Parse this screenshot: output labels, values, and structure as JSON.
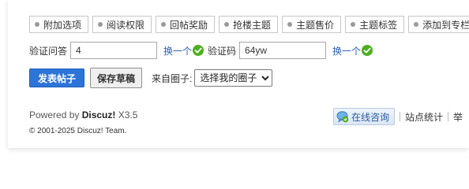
{
  "tabs": [
    {
      "label": "附加选项"
    },
    {
      "label": "阅读权限"
    },
    {
      "label": "回帖奖励"
    },
    {
      "label": "抢楼主题"
    },
    {
      "label": "主题售价"
    },
    {
      "label": "主题标签"
    },
    {
      "label": "添加到专栏"
    }
  ],
  "captcha": {
    "question_label": "验证问答",
    "question_value": "4",
    "refresh_label": "换一个",
    "code_label": "验证码",
    "code_value": "64yw",
    "refresh_label_2": "换一个"
  },
  "actions": {
    "submit_label": "发表帖子",
    "draft_label": "保存草稿",
    "circle_label": "来自圈子:",
    "circle_selected": "选择我的圈子"
  },
  "footer": {
    "powered_prefix": "Powered by ",
    "brand": "Discuz!",
    "version": " X3.5",
    "copyright": "© 2001-2025 Discuz! Team.",
    "consult_label": "在线咨询",
    "stats_label": "站点统计",
    "partial_label": "举"
  },
  "colors": {
    "accent": "#2c74d8",
    "link": "#2b62b8",
    "ok_green": "#4caf1f"
  },
  "icons": {
    "tab_bullet": "bullet-dot-icon",
    "captcha_ok": "check-circle-icon",
    "consult": "chat-bubble-icon"
  }
}
